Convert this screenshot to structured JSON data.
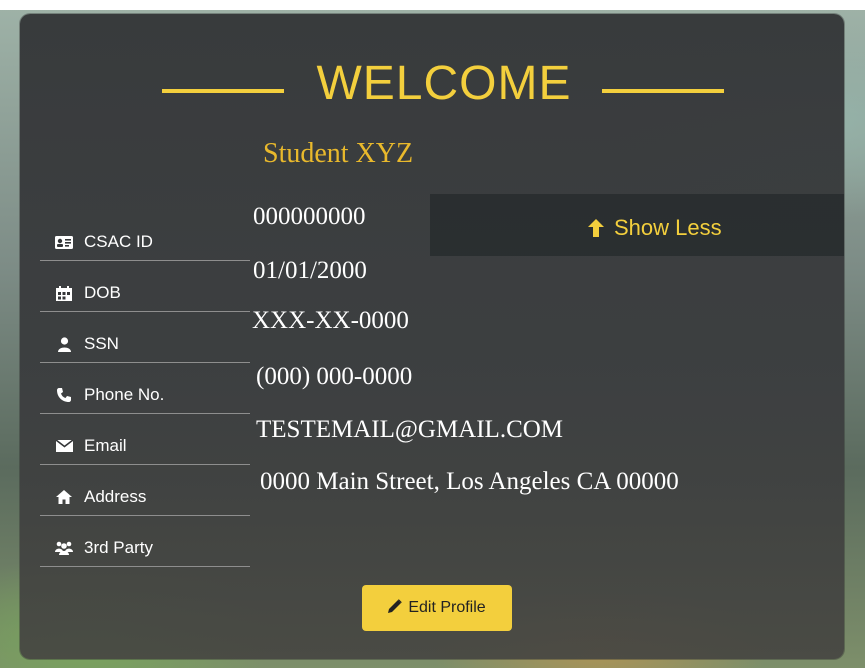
{
  "header": {
    "title": "WELCOME",
    "student_name": "Student XYZ"
  },
  "toggle": {
    "label": "Show Less",
    "icon": "arrow-up-icon"
  },
  "profile": {
    "fields": [
      {
        "label": "CSAC ID",
        "icon": "id-card-icon",
        "value": "000000000"
      },
      {
        "label": "DOB",
        "icon": "calendar-icon",
        "value": "01/01/2000"
      },
      {
        "label": "SSN",
        "icon": "user-icon",
        "value": "XXX-XX-0000"
      },
      {
        "label": "Phone No.",
        "icon": "phone-icon",
        "value": "(000) 000-0000"
      },
      {
        "label": "Email",
        "icon": "envelope-icon",
        "value": "TESTEMAIL@GMAIL.COM"
      },
      {
        "label": "Address",
        "icon": "home-icon",
        "value": "0000 Main Street, Los Angeles CA 00000"
      },
      {
        "label": "3rd Party",
        "icon": "group-icon",
        "value": ""
      }
    ]
  },
  "actions": {
    "edit_label": "Edit Profile",
    "edit_icon": "pencil-icon"
  },
  "colors": {
    "accent": "#f3cf3d",
    "name": "#e9b92c",
    "card": "#343638",
    "text": "#ffffff"
  }
}
